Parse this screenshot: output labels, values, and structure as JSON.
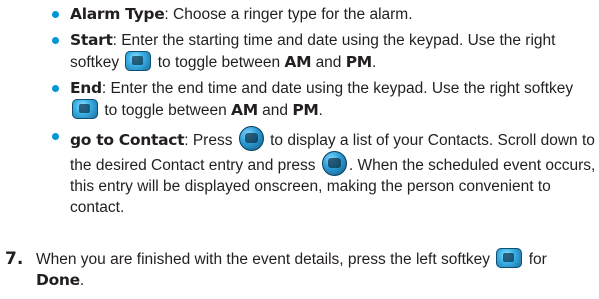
{
  "bullets": [
    {
      "term": "Alarm Type",
      "text": ": Choose a ringer type for the alarm."
    },
    {
      "term": "Start",
      "text_before_icon": ": Enter the starting time and date using the keypad. Use the right softkey",
      "text_after_icon": "to toggle between",
      "am": "AM",
      "and": "and",
      "pm": "PM",
      "end_period": ".",
      "icon": "right-softkey-icon"
    },
    {
      "term": "End",
      "text_before_icon": ": Enter the end time and date using the keypad. Use the right softkey",
      "text_after_icon": "to toggle between",
      "am": "AM",
      "and": "and",
      "pm": "PM",
      "end_period": ".",
      "icon": "right-softkey-icon"
    },
    {
      "term": "go to Contact",
      "text_press": ": Press",
      "text_middle": "to display a list of your Contacts. Scroll down to the desired Contact entry and press",
      "text_end": ". When the scheduled event occurs, this entry will be displayed onscreen, making the person convenient to contact.",
      "icon": "ok-button-icon"
    }
  ],
  "step": {
    "number": "7.",
    "text_before_icon": "When you are finished with the event details, press the left softkey",
    "text_for": "for",
    "done": "Done",
    "end_period": ".",
    "icon": "left-softkey-icon"
  },
  "colors": {
    "bullet": "#0096d6",
    "text": "#231f20"
  }
}
